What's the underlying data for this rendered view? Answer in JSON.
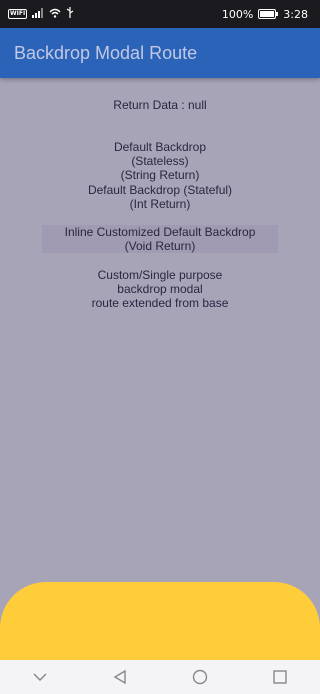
{
  "status_bar": {
    "sim_label": "WIFI",
    "battery": "100%",
    "time": "3:28"
  },
  "app_bar": {
    "title": "Backdrop Modal Route"
  },
  "main": {
    "return_data": "Return Data : null",
    "buttons": [
      {
        "label": "Default Backdrop (Stateless)\n(String Return)"
      },
      {
        "label": "Default Backdrop (Stateful)\n(Int Return)"
      },
      {
        "label": "Inline Customized Default Backdrop\n(Void Return)"
      },
      {
        "label": "Custom/Single purpose backdrop modal\nroute extended from base"
      }
    ]
  },
  "colors": {
    "scrim": "#a7a4b8",
    "app_bar": "#2a63b8",
    "sheet": "#ffcd3a",
    "nav_bar": "#f4f4f6"
  },
  "nav_icons": [
    "chevron-down-icon",
    "back-triangle-icon",
    "home-circle-icon",
    "recents-square-icon"
  ]
}
